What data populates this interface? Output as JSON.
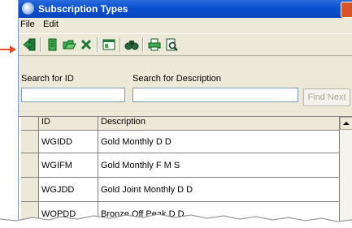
{
  "window": {
    "title": "Subscription Types"
  },
  "menu": [
    "File",
    "Edit"
  ],
  "toolbar": {
    "icons": [
      "exit-icon",
      "new-icon",
      "open-icon",
      "delete-icon",
      "properties-icon",
      "find-icon",
      "print-icon",
      "print-preview-icon"
    ]
  },
  "search": {
    "id_label": "Search for ID",
    "id_value": "",
    "desc_label": "Search for Description",
    "desc_value": "",
    "find_next": "Find Next"
  },
  "table": {
    "columns": [
      "ID",
      "Description"
    ],
    "rows": [
      {
        "id": "WGIDD",
        "description": "Gold Monthly D D"
      },
      {
        "id": "WGIFM",
        "description": "Gold Monthly F M S"
      },
      {
        "id": "WGJDD",
        "description": "Gold Joint Monthly D D"
      },
      {
        "id": "WOPDD",
        "description": "Bronze Off Peak D D"
      }
    ]
  }
}
